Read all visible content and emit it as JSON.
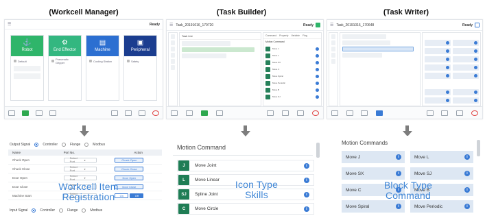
{
  "columns": {
    "left_title": "(Workcell Manager)",
    "middle_title": "(Task Builder)",
    "right_title": "(Task Writer)"
  },
  "workcell_tablet": {
    "status": "Ready",
    "cards": [
      {
        "label": "Robot",
        "color": "#2fb56a",
        "glyph": "⚓",
        "rows": [
          "Default"
        ]
      },
      {
        "label": "End Effector",
        "color": "#33b780",
        "glyph": "⚙",
        "rows": [
          "Pneumatic Gripper"
        ]
      },
      {
        "label": "Machine",
        "color": "#2c6fd1",
        "glyph": "▤",
        "rows": [
          "Cooling Station"
        ]
      },
      {
        "label": "Peripheral",
        "color": "#1b3d8f",
        "glyph": "▣",
        "rows": [
          "Safety"
        ]
      }
    ]
  },
  "builder_tablet": {
    "title": "Task_20191016_170720",
    "status": "Ready",
    "panel_titles": [
      "Task List",
      "Command",
      "Property",
      "Variable",
      "Flag"
    ],
    "motion_header": "Motion Command",
    "commands": [
      "Move J",
      "Move L",
      "Move SX",
      "Move C",
      "Move Spiral",
      "Move Periodic",
      "Move B",
      "Move SJ"
    ]
  },
  "writer_tablet": {
    "title": "Task_20191016_170648",
    "status": "Ready"
  },
  "lower_workcell": {
    "output_signal": "Output Signal",
    "options": [
      "Controller",
      "Flange",
      "Modbus"
    ],
    "input_signal": "Input Signal",
    "headers": [
      "Name",
      "Port No.",
      "Action"
    ],
    "rows": [
      {
        "name": "Chuck Open",
        "port": "Select Port",
        "action": "Chuck Open"
      },
      {
        "name": "Chuck Close",
        "port": "Select Port",
        "action": "Chuck Close"
      },
      {
        "name": "Door Open",
        "port": "Select Port",
        "action": "Door Open"
      },
      {
        "name": "Door Close",
        "port": "Select Port",
        "action": "Door Close"
      },
      {
        "name": "Machine Start",
        "port": "Select Port",
        "action_on": "On",
        "action_off": "Off"
      }
    ],
    "overlay": "Workcell Item Registration"
  },
  "lower_skills": {
    "title": "Motion Command",
    "skills": [
      {
        "icon": "J",
        "label": "Move Joint"
      },
      {
        "icon": "L",
        "label": "Move Linear"
      },
      {
        "icon": "SJ",
        "label": "Spline Joint"
      },
      {
        "icon": "C",
        "label": "Move Circle"
      }
    ],
    "overlay_line1": "Icon Type",
    "overlay_line2": "Skills"
  },
  "lower_blocks": {
    "title": "Motion Commands",
    "blocks": [
      "Move J",
      "Move L",
      "Move SX",
      "Move SJ",
      "Move C",
      "Move B",
      "Move Spiral",
      "Move Periodic"
    ],
    "overlay_line1": "Block Type",
    "overlay_line2": "Command"
  }
}
